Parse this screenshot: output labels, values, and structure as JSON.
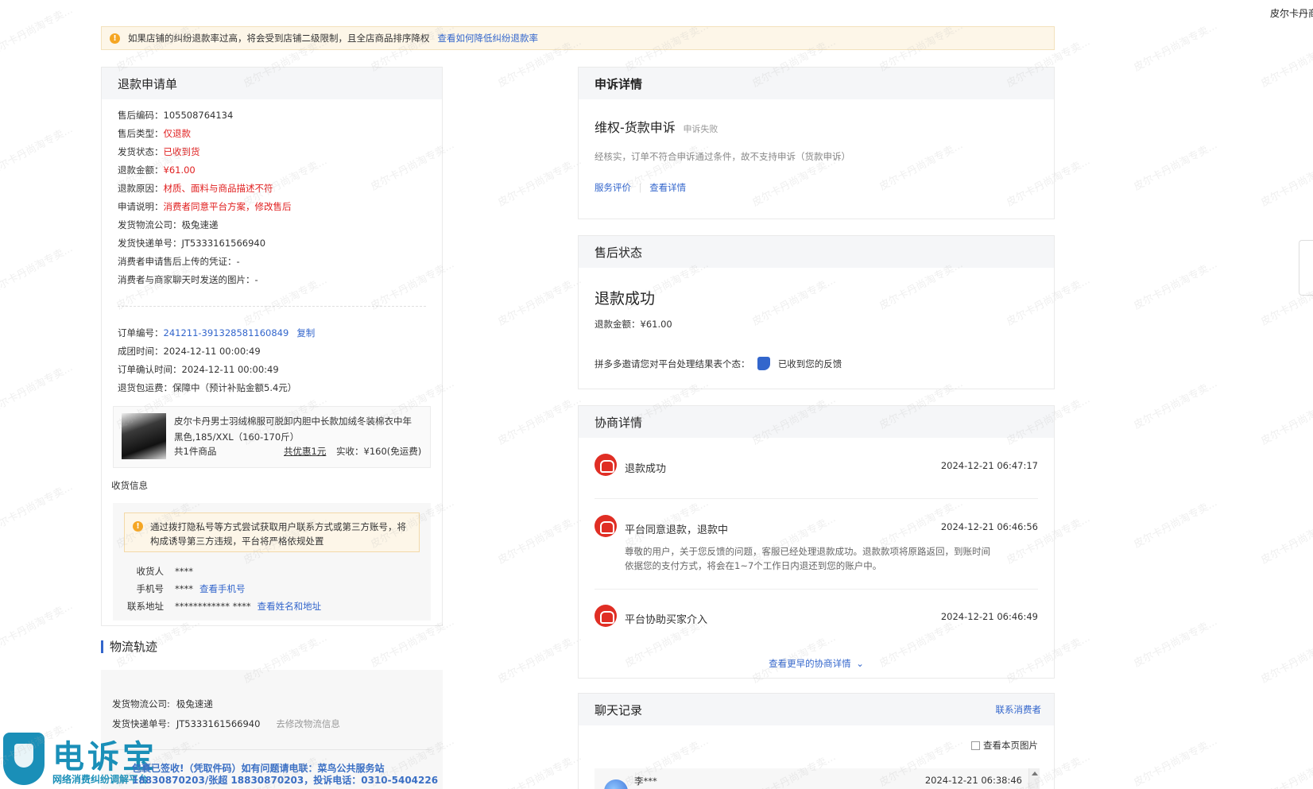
{
  "top_right_name": "皮尔卡丹商",
  "notice": {
    "text": "如果店铺的纠纷退款率过高，将会受到店铺二级限制，且全店商品排序降权",
    "link": "查看如何降低纠纷退款率"
  },
  "refund_form": {
    "title": "退款申请单",
    "rows": [
      {
        "label": "售后编码：",
        "value": "105508764134"
      },
      {
        "label": "售后类型：",
        "value": "仅退款"
      },
      {
        "label": "发货状态：",
        "value": "已收到货"
      },
      {
        "label": "退款金额：",
        "value": "¥61.00"
      },
      {
        "label": "退款原因：",
        "value": "材质、面料与商品描述不符"
      },
      {
        "label": "申请说明：",
        "value": "消费者同意平台方案，修改售后"
      },
      {
        "label": "发货物流公司：",
        "value": "极兔速递"
      },
      {
        "label": "发货快递单号：",
        "value": "JT5333161566940"
      },
      {
        "label": "消费者申请售后上传的凭证：",
        "value": "-"
      },
      {
        "label": "消费者与商家聊天时发送的图片：",
        "value": "-"
      }
    ],
    "order": {
      "order_no_label": "订单编号：",
      "order_no": "241211-391328581160849",
      "copy_label": "复制",
      "group_time_label": "成团时间：",
      "group_time": "2024-12-11 00:00:49",
      "confirm_time_label": "订单确认时间：",
      "confirm_time": "2024-12-11 00:00:49",
      "shipping_label": "退货包运费：",
      "shipping": "保障中（预计补贴金额5.4元）"
    },
    "product": {
      "name": "皮尔卡丹男士羽绒棉服可脱卸内胆中长款加绒冬装棉衣中年",
      "spec": "黑色,185/XXL（160-170斤）",
      "count": "共1件商品",
      "discount": "共优惠1元",
      "paid": "实收：¥160(免运费)"
    },
    "receiver": {
      "title": "收货信息",
      "warning": "通过拨打隐私号等方式尝试获取用户联系方式或第三方账号，将构成诱导第三方违规，平台将严格依规处置",
      "name_label": "收货人",
      "name_value": "****",
      "phone_label": "手机号",
      "phone_value": "****",
      "phone_link": "查看手机号",
      "address_label": "联系地址",
      "address_value": "************ ****",
      "address_link": "查看姓名和地址"
    }
  },
  "logistics": {
    "title": "物流轨迹",
    "company_label": "发货物流公司:",
    "company": "极兔速递",
    "tracking_label": "发货快递单号:",
    "tracking": "JT5333161566940",
    "tracking_link": "去修改物流信息"
  },
  "appeal": {
    "title": "申诉详情",
    "type": "维权-货款申诉",
    "status": "申诉失败",
    "desc": "经核实，订单不符合申诉通过条件，故不支持申诉（货款申诉）",
    "rate_link": "服务评价",
    "detail_link": "查看详情"
  },
  "after_sale": {
    "title": "售后状态",
    "status": "退款成功",
    "amount": "退款金额：¥61.00",
    "feedback_prompt": "拼多多邀请您对平台处理结果表个态：",
    "feedback_status": "已收到您的反馈"
  },
  "negotiation": {
    "title": "协商详情",
    "items": [
      {
        "title": "退款成功",
        "time": "2024-12-21 06:47:17",
        "desc1": "",
        "desc2": ""
      },
      {
        "title": "平台同意退款，退款中",
        "time": "2024-12-21 06:46:56",
        "desc1": "尊敬的用户，关于您反馈的问题，客服已经处理退款成功。退款款项将原路返回，到账时间",
        "desc2": "依据您的支付方式，将会在1~7个工作日内退还到您的账户中。"
      },
      {
        "title": "平台协助买家介入",
        "time": "2024-12-21 06:46:49",
        "desc1": "",
        "desc2": ""
      }
    ],
    "more_link": "查看更早的协商详情"
  },
  "chat": {
    "title": "聊天记录",
    "contact_link": "联系消费者",
    "view_images": "查看本页图片",
    "first_name": "李***",
    "first_time": "2024-12-21 06:38:46"
  },
  "logo": {
    "text": "电诉宝",
    "sub": "网络消费纠纷调解平台"
  },
  "promo": {
    "line1": "包裹已签收!（凭取件码）如有问题请电联：菜鸟公共服务站",
    "line2": "18830870203/张超 18830870203，投诉电话：0310-5404226"
  },
  "watermark": "皮尔卡丹尚淘专卖..."
}
